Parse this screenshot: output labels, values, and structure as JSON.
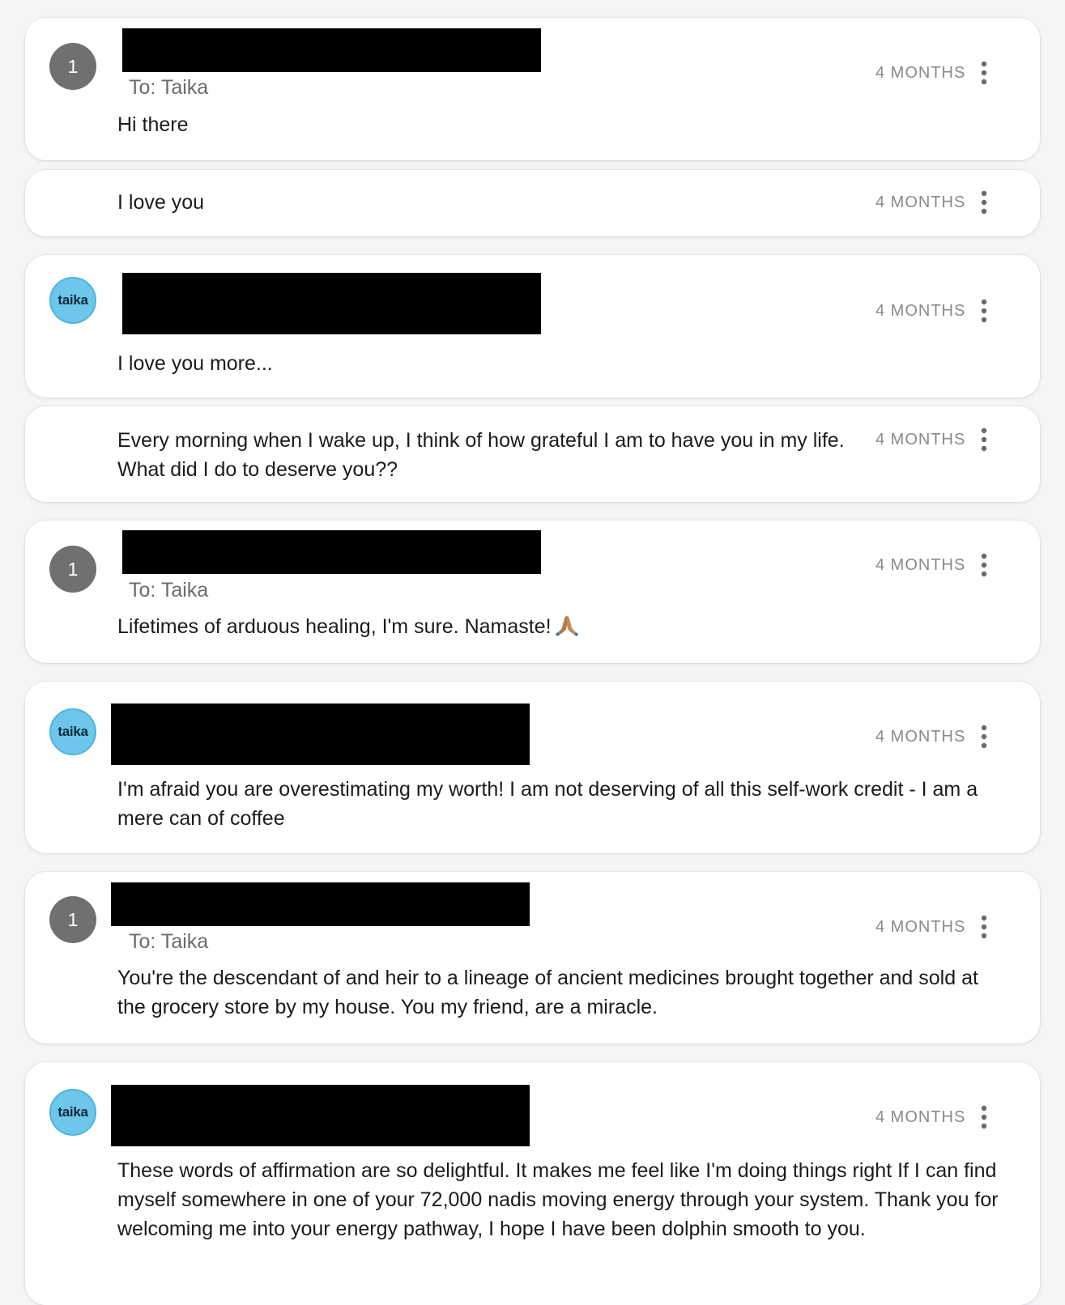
{
  "messages": [
    {
      "avatar_text": "1",
      "avatar_kind": "number",
      "recipient": "To: Taika",
      "body": "Hi there",
      "time": "4 MONTHS"
    },
    {
      "body": "I love you",
      "time": "4 MONTHS"
    },
    {
      "avatar_text": "taika",
      "avatar_kind": "brand",
      "body": "I love you more...",
      "time": "4 MONTHS"
    },
    {
      "body": "Every morning when I wake up, I think of how grateful I am to have you in my life. What did I do to deserve you??",
      "time": "4 MONTHS"
    },
    {
      "avatar_text": "1",
      "avatar_kind": "number",
      "recipient": "To: Taika",
      "body": "Lifetimes of arduous healing, I'm sure. Namaste!",
      "emoji": "folded-hands-icon",
      "time": "4 MONTHS"
    },
    {
      "avatar_text": "taika",
      "avatar_kind": "brand",
      "body": "I'm afraid you are overestimating my worth! I am not deserving of all this self-work credit - I am a mere can of coffee",
      "time": "4 MONTHS"
    },
    {
      "avatar_text": "1",
      "avatar_kind": "number",
      "recipient": "To: Taika",
      "body": "You're the descendant of and heir to a lineage of ancient medicines brought together and sold at the grocery store by my house. You my friend, are a miracle.",
      "time": "4 MONTHS"
    },
    {
      "avatar_text": "taika",
      "avatar_kind": "brand",
      "body": "These words of affirmation are so delightful. It makes me feel like I'm doing things right If I can find myself somewhere in one of your 72,000 nadis moving energy through your system. Thank you for welcoming me into your energy pathway, I hope I have been dolphin smooth to you.",
      "time": "4 MONTHS"
    }
  ],
  "colors": {
    "background": "#f4f5f7",
    "card": "#ffffff",
    "number_avatar": "#707070",
    "brand_avatar": "#6ec6ea",
    "redaction": "#000000",
    "muted_text": "#8a8a8e"
  },
  "icons": {
    "more": "more-vertical-icon",
    "emoji": "folded-hands-icon"
  }
}
